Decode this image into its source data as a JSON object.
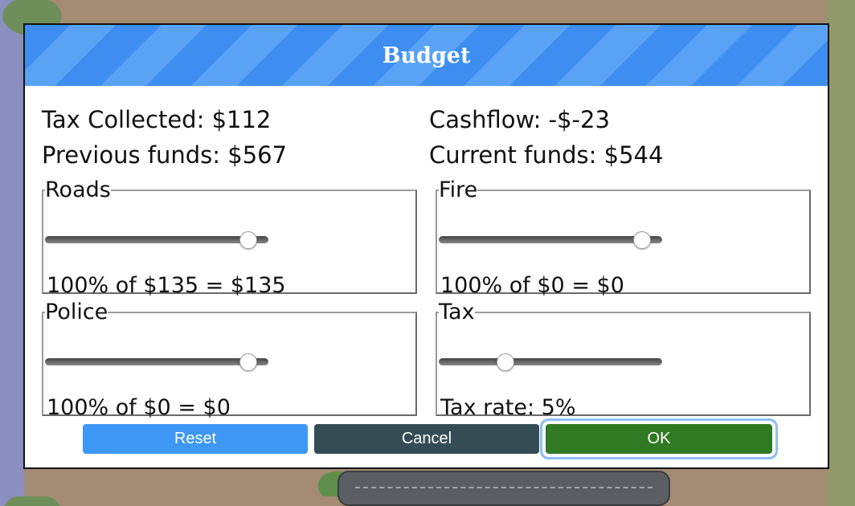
{
  "dialog": {
    "title": "Budget"
  },
  "stats": {
    "tax_collected": "Tax Collected: $112",
    "cashflow": "Cashflow: -$-23",
    "previous_funds": "Previous funds: $567",
    "current_funds": "Current funds: $544"
  },
  "panels": {
    "roads": {
      "legend": "Roads",
      "value_text": "100% of $135 = $135",
      "slider_fraction": 0.91
    },
    "fire": {
      "legend": "Fire",
      "value_text": "100% of $0 = $0",
      "slider_fraction": 0.91
    },
    "police": {
      "legend": "Police",
      "value_text": "100% of $0 = $0",
      "slider_fraction": 0.91
    },
    "tax": {
      "legend": "Tax",
      "value_text": "Tax rate: 5%",
      "slider_fraction": 0.3
    }
  },
  "buttons": {
    "reset": "Reset",
    "cancel": "Cancel",
    "ok": "OK"
  },
  "colors": {
    "reset": "#3d97f5",
    "cancel": "#354c54",
    "ok": "#2f7a22",
    "ok_focus": "#8fbef5",
    "title_stripe_a": "#3d8ef0",
    "title_stripe_b": "#5aa2f5"
  }
}
